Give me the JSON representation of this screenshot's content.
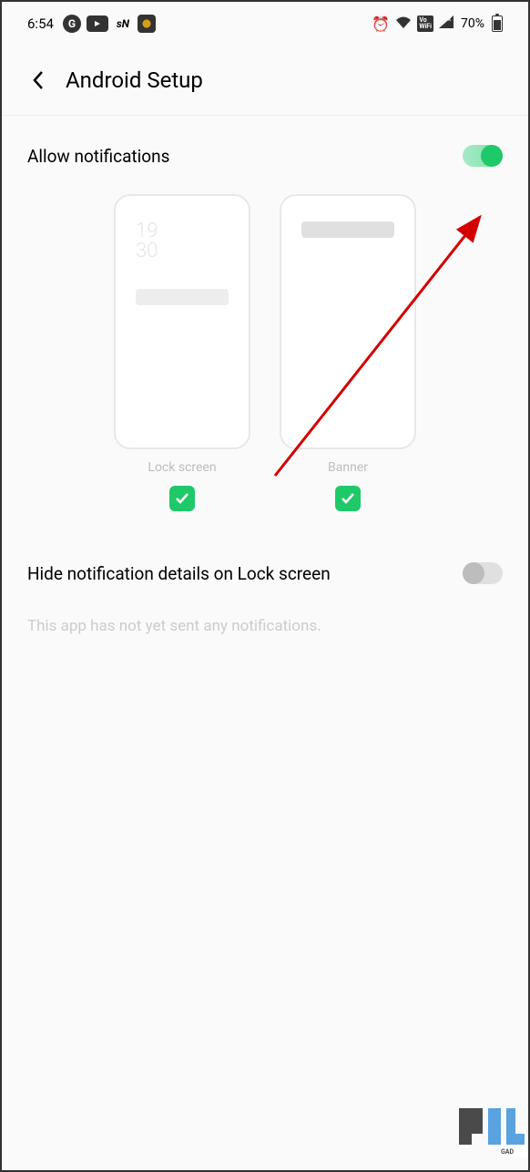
{
  "status_bar": {
    "time": "6:54",
    "battery_pct": "70%"
  },
  "header": {
    "title": "Android Setup"
  },
  "allow_notifications": {
    "label": "Allow notifications",
    "enabled": true
  },
  "previews": [
    {
      "label": "Lock screen",
      "checked": true,
      "mock_time": "19\n30"
    },
    {
      "label": "Banner",
      "checked": true
    }
  ],
  "hide_details": {
    "label": "Hide notification details on Lock screen",
    "enabled": false
  },
  "info_text": "This app has not yet sent any notifications."
}
